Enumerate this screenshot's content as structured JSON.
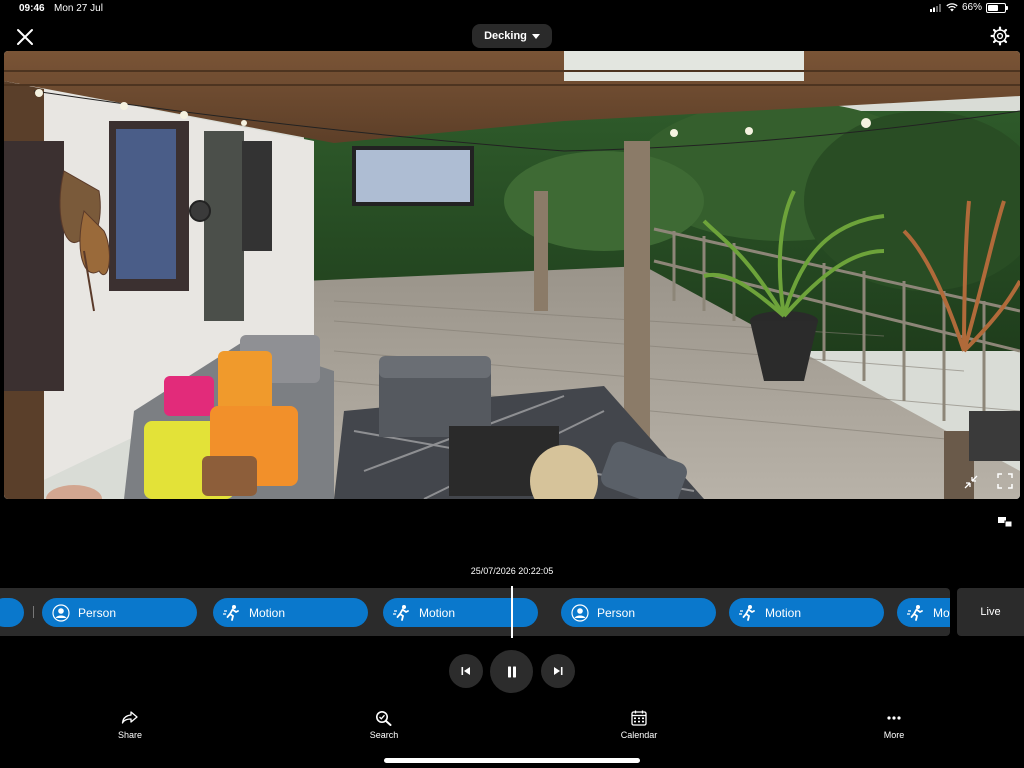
{
  "status_bar": {
    "time": "09:46",
    "date": "Mon 27 Jul",
    "battery": "66%",
    "battery_level": 0.66
  },
  "header": {
    "camera_name": "Decking",
    "icons": [
      "close-icon",
      "chevron-down-icon",
      "gear-icon"
    ]
  },
  "video": {
    "icons": [
      "exit-fullscreen-icon",
      "fullscreen-icon",
      "picture-in-picture-icon"
    ]
  },
  "timeline": {
    "timestamp": "25/07/2026 20:22:05",
    "events": [
      {
        "type": "partial",
        "label": ""
      },
      {
        "type": "person",
        "label": "Person"
      },
      {
        "type": "motion",
        "label": "Motion"
      },
      {
        "type": "motion",
        "label": "Motion"
      },
      {
        "type": "person",
        "label": "Person"
      },
      {
        "type": "motion",
        "label": "Motion"
      },
      {
        "type": "motion",
        "label": "Motion"
      }
    ],
    "live_label": "Live",
    "event_color": "#0a78cc"
  },
  "playback": {
    "icons": [
      "skip-previous-icon",
      "pause-icon",
      "skip-next-icon"
    ]
  },
  "actions": [
    {
      "label": "Share",
      "icon": "share-icon"
    },
    {
      "label": "Search",
      "icon": "search-icon"
    },
    {
      "label": "Calendar",
      "icon": "calendar-icon"
    },
    {
      "label": "More",
      "icon": "more-icon"
    }
  ]
}
